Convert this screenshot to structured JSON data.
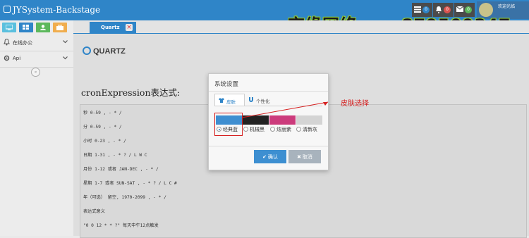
{
  "app": {
    "title": "JYSystem-Backstage"
  },
  "topbar": {
    "badges": [
      {
        "icon": "list-icon",
        "count": "0",
        "color": "#2f85c8"
      },
      {
        "icon": "bell-icon",
        "count": "0",
        "color": "#d9534f"
      },
      {
        "icon": "envelope-icon",
        "count": "0",
        "color": "#5cb85c"
      }
    ],
    "user": {
      "welcome": "欢迎光临"
    }
  },
  "watermark": {
    "text": "京缘网络 qq: 879509347"
  },
  "sidebar": {
    "shortcuts": [
      {
        "icon": "monitor-icon",
        "color": "#5bc0de"
      },
      {
        "icon": "grid-icon",
        "color": "#2f85c8"
      },
      {
        "icon": "user-icon",
        "color": "#5cb85c"
      },
      {
        "icon": "briefcase-icon",
        "color": "#f0ad4e"
      }
    ],
    "menus": [
      {
        "label": "在线办公"
      },
      {
        "label": "Api"
      }
    ]
  },
  "tabs": [
    {
      "label": "Quartz"
    }
  ],
  "content": {
    "logo": "QUARTZ",
    "title": "cronExpression表达式:",
    "lines": [
      "秒 0-59 , - * /",
      "分 0-59 , - * /",
      "小时 0-23 , - * /",
      "日期 1-31 , - * ? / L W C",
      "月份 1-12 或者 JAN-DEC , - * /",
      "星期 1-7 或者 SUN-SAT , - * ? / L C #",
      "年（可选） 留空, 1970-2099 , - * /",
      "表达式意义",
      "\"0 0 12 * * ?\" 每天中午12点触发"
    ]
  },
  "dialog": {
    "title": "系统设置",
    "tabs": {
      "skin": "皮肤",
      "personal": "个性化"
    },
    "skins": [
      {
        "label": "经典蓝",
        "color": "#3e8ed0",
        "selected": true
      },
      {
        "label": "机械黑",
        "color": "#222222",
        "selected": false
      },
      {
        "label": "炫丽紫",
        "color": "#cc3b7c",
        "selected": false
      },
      {
        "label": "清新灰",
        "color": "#d4d4d4",
        "selected": false
      }
    ],
    "confirm": "确认",
    "cancel": "取消"
  },
  "annotation": {
    "label": "皮肤选择",
    "color": "#d62020"
  }
}
